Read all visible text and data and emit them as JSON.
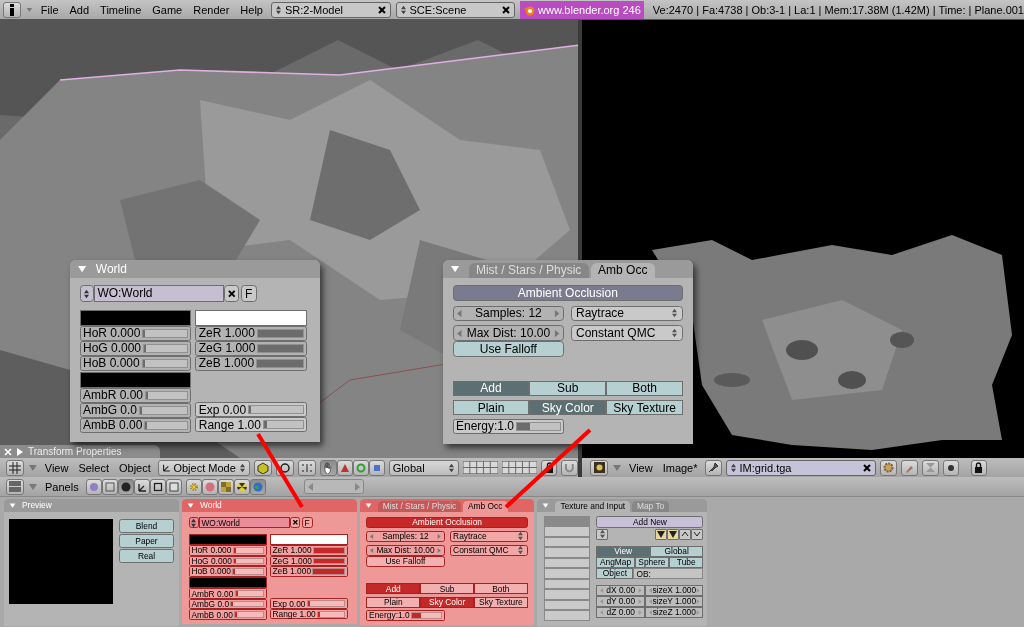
{
  "top_bar": {
    "menus": [
      "File",
      "Add",
      "Timeline",
      "Game",
      "Render",
      "Help"
    ],
    "screen": "SR:2-Model",
    "scene": "SCE:Scene",
    "link": "www.blender.org 246",
    "stats": "Ve:2470 | Fa:4738 | Ob:3-1 | La:1 | Mem:17.38M (1.42M) | Time: | Plane.001"
  },
  "transform_properties": {
    "title": "Transform Properties"
  },
  "view3d_header": {
    "menus": [
      "View",
      "Select",
      "Object"
    ],
    "mode": "Object Mode",
    "orientation": "Global"
  },
  "image_header": {
    "menus": [
      "View",
      "Image*"
    ],
    "image": "IM:grid.tga"
  },
  "buttons_header": {
    "label": "Panels"
  },
  "world_popup": {
    "title": "World",
    "name": "WO:World",
    "fake_user": "F",
    "horizon": {
      "color": "#000000",
      "sliders": [
        {
          "label": "HoR 0.000",
          "level": 0
        },
        {
          "label": "HoG 0.000",
          "level": 0
        },
        {
          "label": "HoB 0.000",
          "level": 0
        }
      ]
    },
    "zenith": {
      "color": "#ffffff",
      "sliders": [
        {
          "label": "ZeR 1.000",
          "level": 1
        },
        {
          "label": "ZeG 1.000",
          "level": 1
        },
        {
          "label": "ZeB 1.000",
          "level": 1
        }
      ]
    },
    "ambient": {
      "color": "#000000",
      "sliders": [
        {
          "label": "AmbR 0.00",
          "level": 0
        },
        {
          "label": "AmbG 0.0",
          "level": 0
        },
        {
          "label": "AmbB 0.00",
          "level": 0
        }
      ]
    },
    "exposure": [
      {
        "label": "Exp 0.00",
        "level": 0
      },
      {
        "label": "Range 1.00",
        "level": 0.08
      }
    ]
  },
  "amb_occ_popup": {
    "tabs": [
      {
        "label": "Mist / Stars / Physic",
        "selected": false
      },
      {
        "label": "Amb Occ",
        "selected": true
      }
    ],
    "title": "Ambient Occlusion",
    "samples": "Samples: 12",
    "max_dist": "Max Dist: 10.00",
    "use_falloff": {
      "label": "Use Falloff",
      "on": false
    },
    "method": "Raytrace",
    "sampling": "Constant QMC",
    "blend": [
      {
        "label": "Add",
        "selected": true
      },
      {
        "label": "Sub",
        "selected": false
      },
      {
        "label": "Both",
        "selected": false
      }
    ],
    "color_source": [
      {
        "label": "Plain",
        "selected": false
      },
      {
        "label": "Sky Color",
        "selected": true
      },
      {
        "label": "Sky Texture",
        "selected": false
      }
    ],
    "energy": {
      "label": "Energy:1.0",
      "level": 0.3
    }
  },
  "preview_panel": {
    "title": "Preview",
    "buttons": [
      "Blend",
      "Paper",
      "Real"
    ]
  },
  "world_panel": {
    "title": "World",
    "name": "WO:World",
    "fake_user": "F",
    "horizon": {
      "color": "#000000",
      "sliders": [
        {
          "label": "HoR 0.000",
          "level": 0
        },
        {
          "label": "HoG 0.000",
          "level": 0
        },
        {
          "label": "HoB 0.000",
          "level": 0
        }
      ]
    },
    "zenith": {
      "color": "#ffffff",
      "sliders": [
        {
          "label": "ZeR 1.000",
          "level": 1
        },
        {
          "label": "ZeG 1.000",
          "level": 1
        },
        {
          "label": "ZeB 1.000",
          "level": 1
        }
      ]
    },
    "ambient": {
      "color": "#000000",
      "sliders": [
        {
          "label": "AmbR 0.00",
          "level": 0
        },
        {
          "label": "AmbG 0.0",
          "level": 0
        },
        {
          "label": "AmbB 0.00",
          "level": 0
        }
      ]
    },
    "exposure": [
      {
        "label": "Exp 0.00",
        "level": 0
      },
      {
        "label": "Range 1.00",
        "level": 0.08
      }
    ]
  },
  "amb_occ_panel": {
    "tabs": [
      {
        "label": "Mist / Stars / Physic",
        "selected": false
      },
      {
        "label": "Amb Occ",
        "selected": true
      }
    ],
    "title": "Ambient Occlusion",
    "samples": "Samples: 12",
    "max_dist": "Max Dist: 10.00",
    "use_falloff": {
      "label": "Use Falloff",
      "on": false
    },
    "method": "Raytrace",
    "sampling": "Constant QMC",
    "blend": [
      {
        "label": "Add",
        "selected": true
      },
      {
        "label": "Sub",
        "selected": false
      },
      {
        "label": "Both",
        "selected": false
      }
    ],
    "color_source": [
      {
        "label": "Plain",
        "selected": false
      },
      {
        "label": "Sky Color",
        "selected": true
      },
      {
        "label": "Sky Texture",
        "selected": false
      }
    ],
    "energy": {
      "label": "Energy:1.0",
      "level": 0.3
    }
  },
  "texture_panel": {
    "tabs": [
      {
        "label": "Texture and Input",
        "selected": true
      },
      {
        "label": "Map To",
        "selected": false
      }
    ],
    "slots": [
      {
        "selected": true
      },
      {
        "selected": false
      },
      {
        "selected": false
      },
      {
        "selected": false
      },
      {
        "selected": false
      },
      {
        "selected": false
      },
      {
        "selected": false
      },
      {
        "selected": false
      },
      {
        "selected": false
      },
      {
        "selected": false
      }
    ],
    "add_new": "Add New",
    "coords": [
      {
        "label": "View",
        "selected": true
      },
      {
        "label": "Global",
        "selected": false
      }
    ],
    "projections": [
      {
        "label": "AngMap",
        "selected": false
      },
      {
        "label": "Sphere",
        "selected": false
      },
      {
        "label": "Tube",
        "selected": false
      }
    ],
    "object": "Object",
    "object_field": "OB:",
    "offsets": [
      "dX 0.00",
      "dY 0.00",
      "dZ 0.00"
    ],
    "sizes": [
      "sizeX 1.000",
      "sizeY 1.000",
      "sizeZ 1.000"
    ]
  }
}
